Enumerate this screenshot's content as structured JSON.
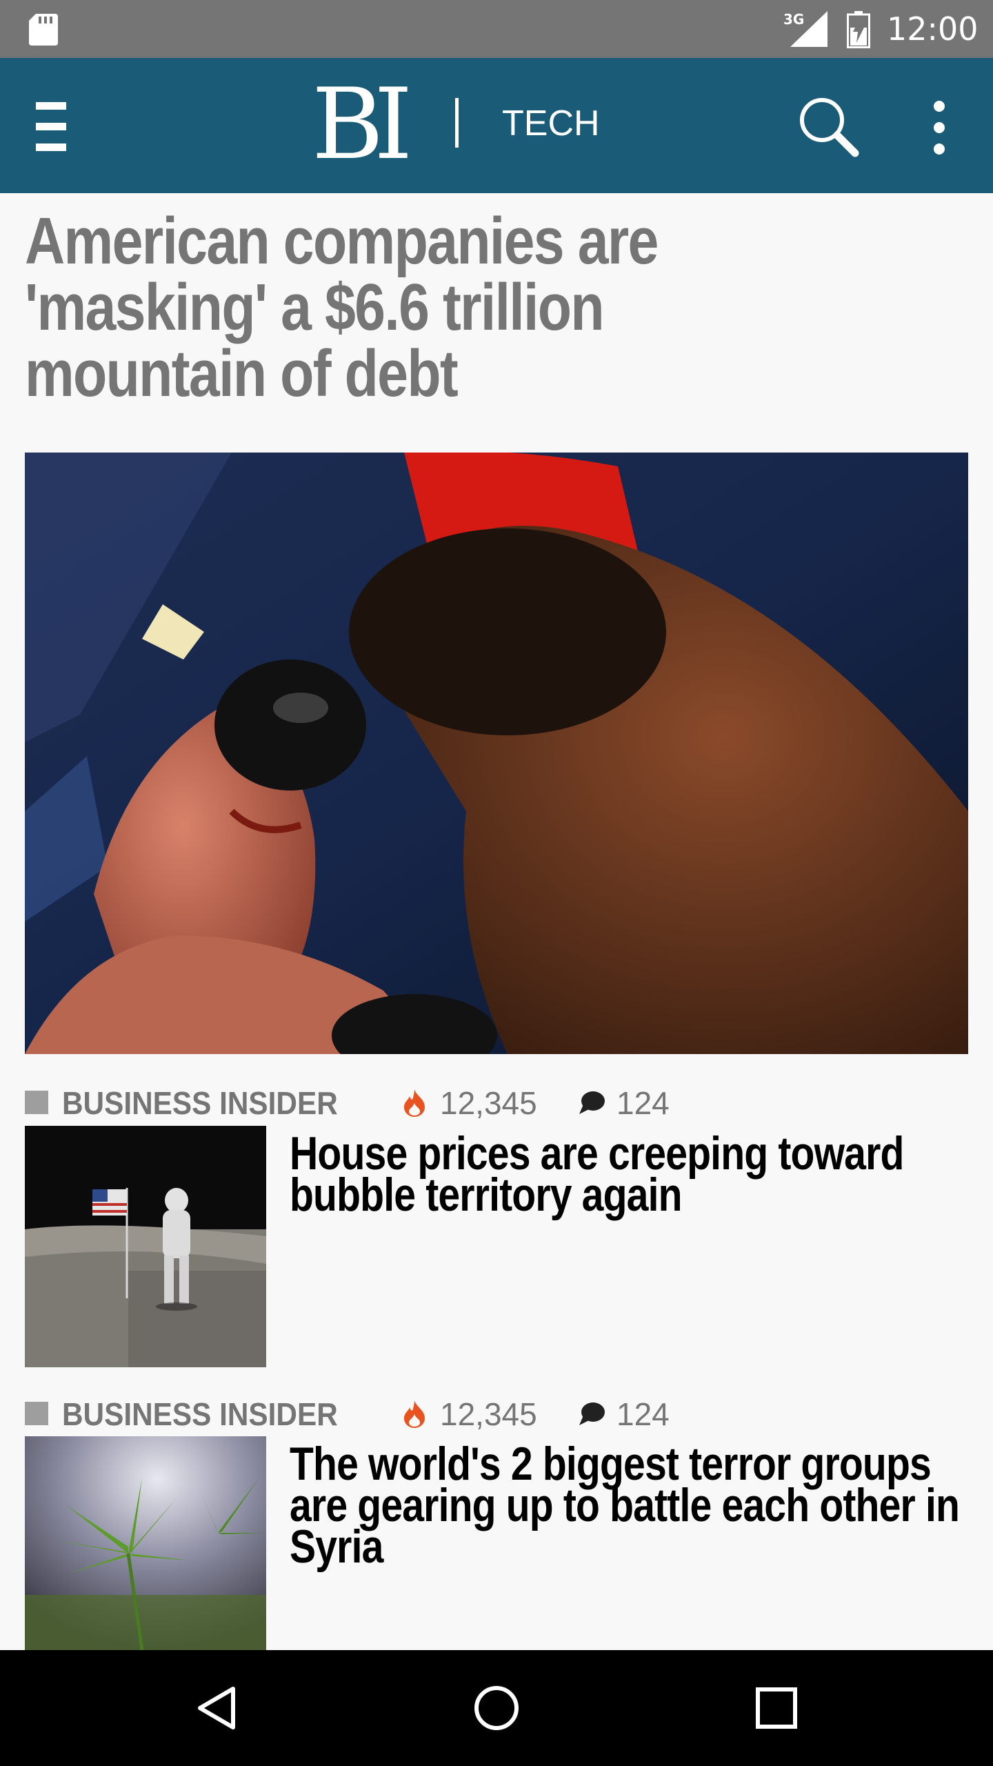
{
  "status_bar": {
    "network": "3G",
    "time": "12:00"
  },
  "app_bar": {
    "logo_text": "BI",
    "section": "TECH",
    "icons": [
      "menu-icon",
      "search-icon",
      "more-vert-icon"
    ],
    "color": "#1a5c78"
  },
  "lead_story": {
    "headline": "American companies are 'masking' a $6.6 trillion mountain of debt"
  },
  "stories": [
    {
      "source": "BUSINESS INSIDER",
      "views": "12,345",
      "comments": "124",
      "title": "House prices are creeping toward bubble territory again"
    },
    {
      "source": "BUSINESS INSIDER",
      "views": "12,345",
      "comments": "124",
      "title": "The world's 2 biggest terror groups are gearing up to battle each other in Syria"
    }
  ],
  "nav_bar": {
    "icons": [
      "back-icon",
      "home-icon",
      "recents-icon"
    ]
  },
  "colors": {
    "accent": "#1a5c78",
    "fire": "#e8531f",
    "meta_text": "#757575"
  }
}
